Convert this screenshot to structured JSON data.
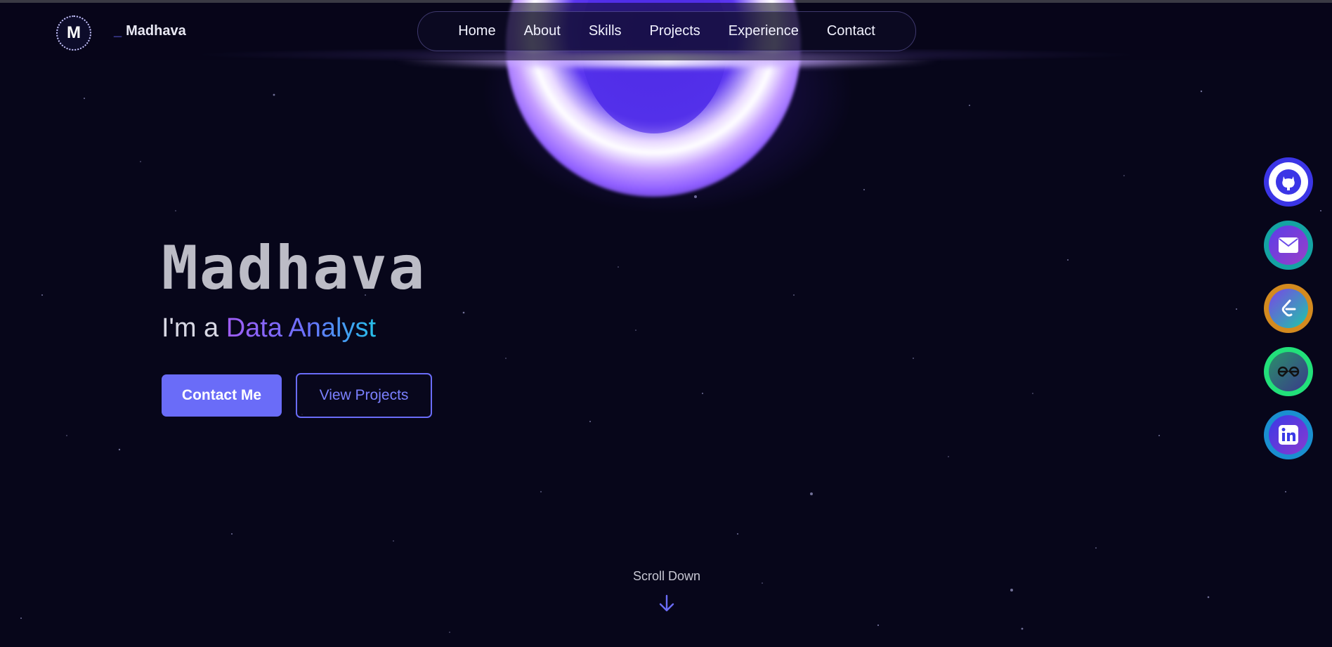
{
  "header": {
    "logo_letter": "M",
    "brand_prefix": "_",
    "brand_name": "Madhava"
  },
  "nav": {
    "items": [
      {
        "label": "Home"
      },
      {
        "label": "About"
      },
      {
        "label": "Skills"
      },
      {
        "label": "Projects"
      },
      {
        "label": "Experience"
      },
      {
        "label": "Contact"
      }
    ]
  },
  "hero": {
    "name": "Madhava",
    "sub_prefix": "I'm a ",
    "role": "Data Analyst",
    "primary_button": "Contact Me",
    "secondary_button": "View Projects"
  },
  "scroll": {
    "label": "Scroll Down"
  },
  "social": [
    {
      "icon": "github-icon",
      "color": "#3b35e6"
    },
    {
      "icon": "mail-icon",
      "color": "#14a3a3"
    },
    {
      "icon": "leetcode-icon",
      "color": "#d38a1f"
    },
    {
      "icon": "geeksforgeeks-icon",
      "color": "#22e07a"
    },
    {
      "icon": "linkedin-icon",
      "color": "#1a8fd0"
    }
  ],
  "colors": {
    "background": "#07061a",
    "accent": "#6a6cf8",
    "glow": "#8e5dff"
  }
}
